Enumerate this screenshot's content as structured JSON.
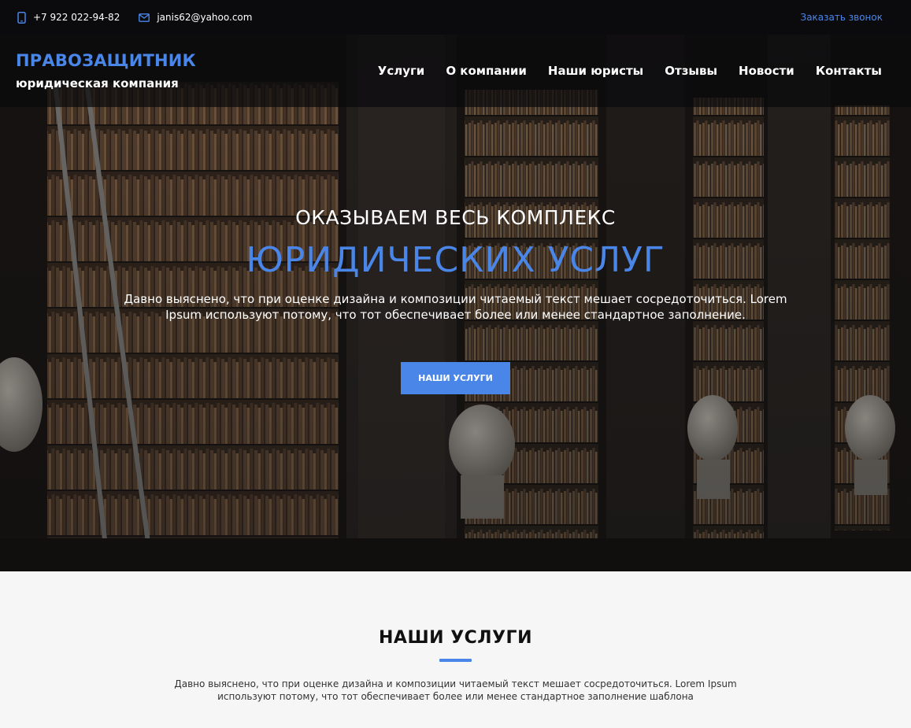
{
  "topbar": {
    "phone": "+7 922 022-94-82",
    "email": "janis62@yahoo.com",
    "callback": "Заказать звонок",
    "phone_icon": "phone-icon",
    "email_icon": "envelope-icon"
  },
  "navbar": {
    "logo": "ПРАВОЗАЩИТНИК",
    "tagline": "юридическая компания",
    "items": [
      {
        "label": "Услуги"
      },
      {
        "label": "О компании"
      },
      {
        "label": "Наши юристы"
      },
      {
        "label": "Отзывы"
      },
      {
        "label": "Новости"
      },
      {
        "label": "Контакты"
      }
    ]
  },
  "hero": {
    "subtitle": "ОКАЗЫВАЕМ ВЕСЬ КОМПЛЕКС",
    "title": "ЮРИДИЧЕСКИХ УСЛУГ",
    "text": "Давно выяснено, что при оценке дизайна и композиции читаемый текст мешает сосредоточиться. Lorem Ipsum используют потому, что тот обеспечивает более или менее стандартное заполнение.",
    "button": "НАШИ УСЛУГИ",
    "background": "library-bookshelves-image"
  },
  "services": {
    "title": "НАШИ УСЛУГИ",
    "text": "Давно выяснено, что при оценке дизайна и композиции читаемый текст мешает сосредоточиться. Lorem Ipsum используют потому, что тот обеспечивает более или менее стандартное заполнение шаблона"
  },
  "colors": {
    "accent": "#4a86e8",
    "topbar": "#0b0b0d",
    "section_bg": "#f6f6f6"
  }
}
